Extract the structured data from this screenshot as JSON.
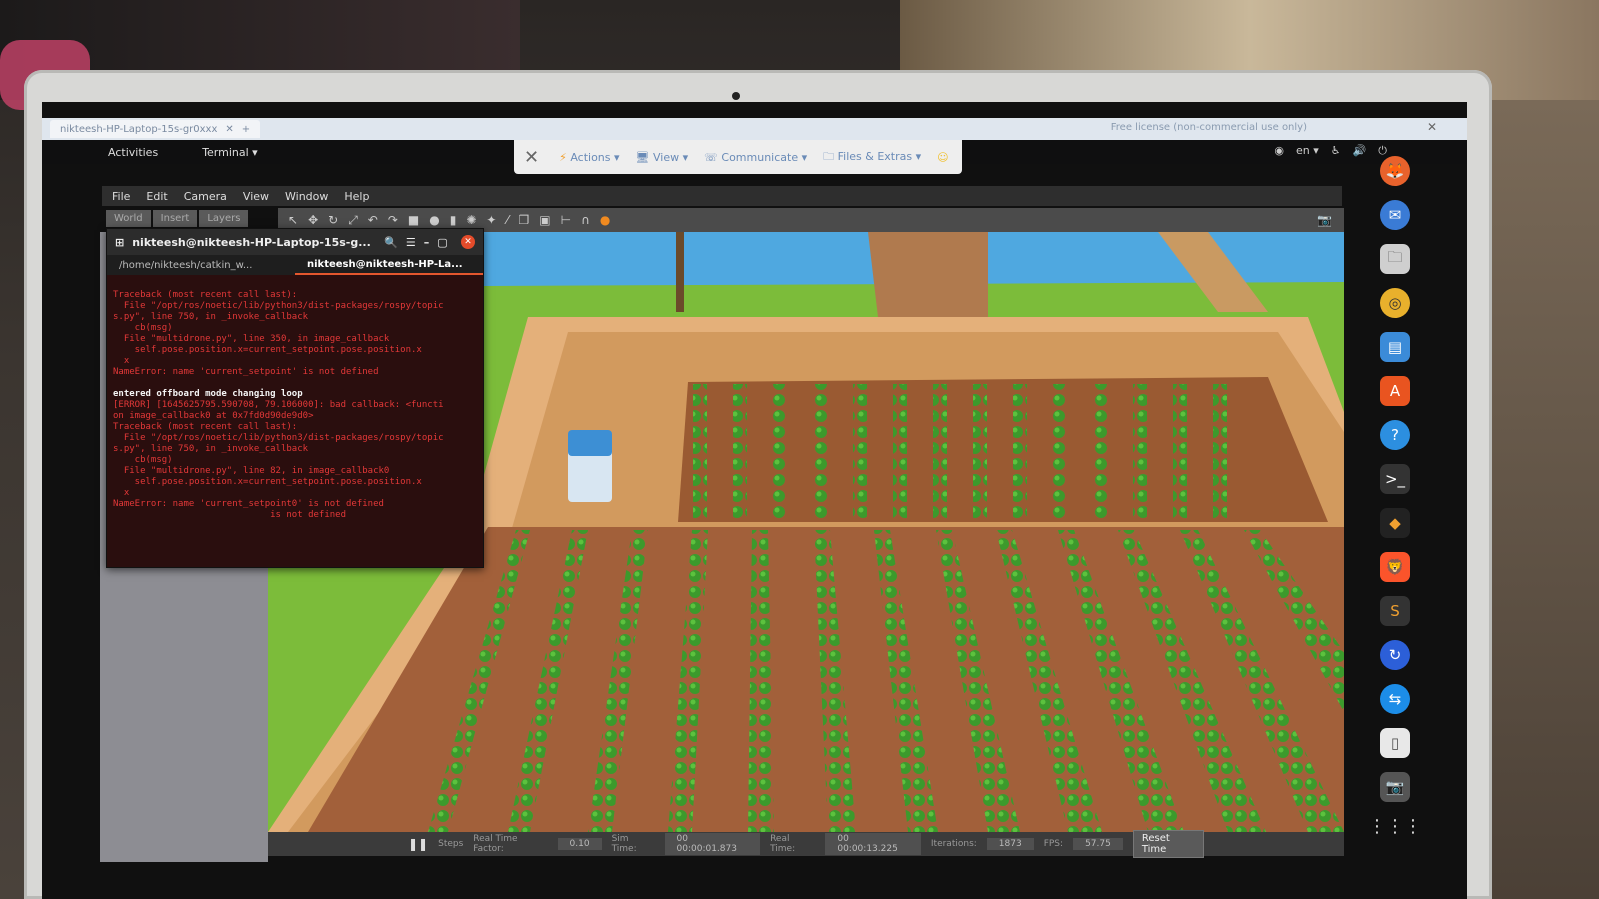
{
  "windows_bar": {
    "tab_title": "nikteesh-HP-Laptop-15s-gr0xxx",
    "license_text": "Free license (non-commercial use only)"
  },
  "ubuntu_bar": {
    "activities": "Activities",
    "app_menu": "Terminal ▾",
    "lang": "en ▾"
  },
  "anydesk": {
    "actions": "Actions ▾",
    "view": "View ▾",
    "communicate": "Communicate ▾",
    "files": "Files & Extras ▾"
  },
  "gazebo": {
    "menu": [
      "File",
      "Edit",
      "Camera",
      "View",
      "Window",
      "Help"
    ],
    "side_tabs": [
      "World",
      "Insert",
      "Layers"
    ],
    "bottom": {
      "steps_label": "Steps",
      "rtf_label": "Real Time Factor:",
      "rtf": "0.10",
      "sim_time_label": "Sim Time:",
      "sim_time": "00 00:00:01.873",
      "real_time_label": "Real Time:",
      "real_time": "00 00:00:13.225",
      "iterations_label": "Iterations:",
      "iterations": "1873",
      "fps_label": "FPS:",
      "fps": "57.75",
      "reset": "Reset Time"
    }
  },
  "terminal": {
    "title": "nikteesh@nikteesh-HP-Laptop-15s-g...",
    "tab1": "/home/nikteesh/catkin_w...",
    "tab2": "nikteesh@nikteesh-HP-La...",
    "lines": [
      "Traceback (most recent call last):",
      "  File \"/opt/ros/noetic/lib/python3/dist-packages/rospy/topic",
      "s.py\", line 750, in _invoke_callback",
      "    cb(msg)",
      "  File \"multidrone.py\", line 350, in image_callback",
      "    self.pose.position.x=current_setpoint.pose.position.x",
      "  x",
      "NameError: name 'current_setpoint' is not defined",
      "",
      "entered offboard mode changing loop",
      "[ERROR] [1645625795.590708, 79.106000]: bad callback: <functi",
      "on image_callback0 at 0x7fd0d90de9d0>",
      "Traceback (most recent call last):",
      "  File \"/opt/ros/noetic/lib/python3/dist-packages/rospy/topic",
      "s.py\", line 750, in _invoke_callback",
      "    cb(msg)",
      "  File \"multidrone.py\", line 82, in image_callback0",
      "    self.pose.position.x=current_setpoint.pose.position.x",
      "  x",
      "NameError: name 'current_setpoint0' is not defined",
      "                             is not defined"
    ]
  }
}
